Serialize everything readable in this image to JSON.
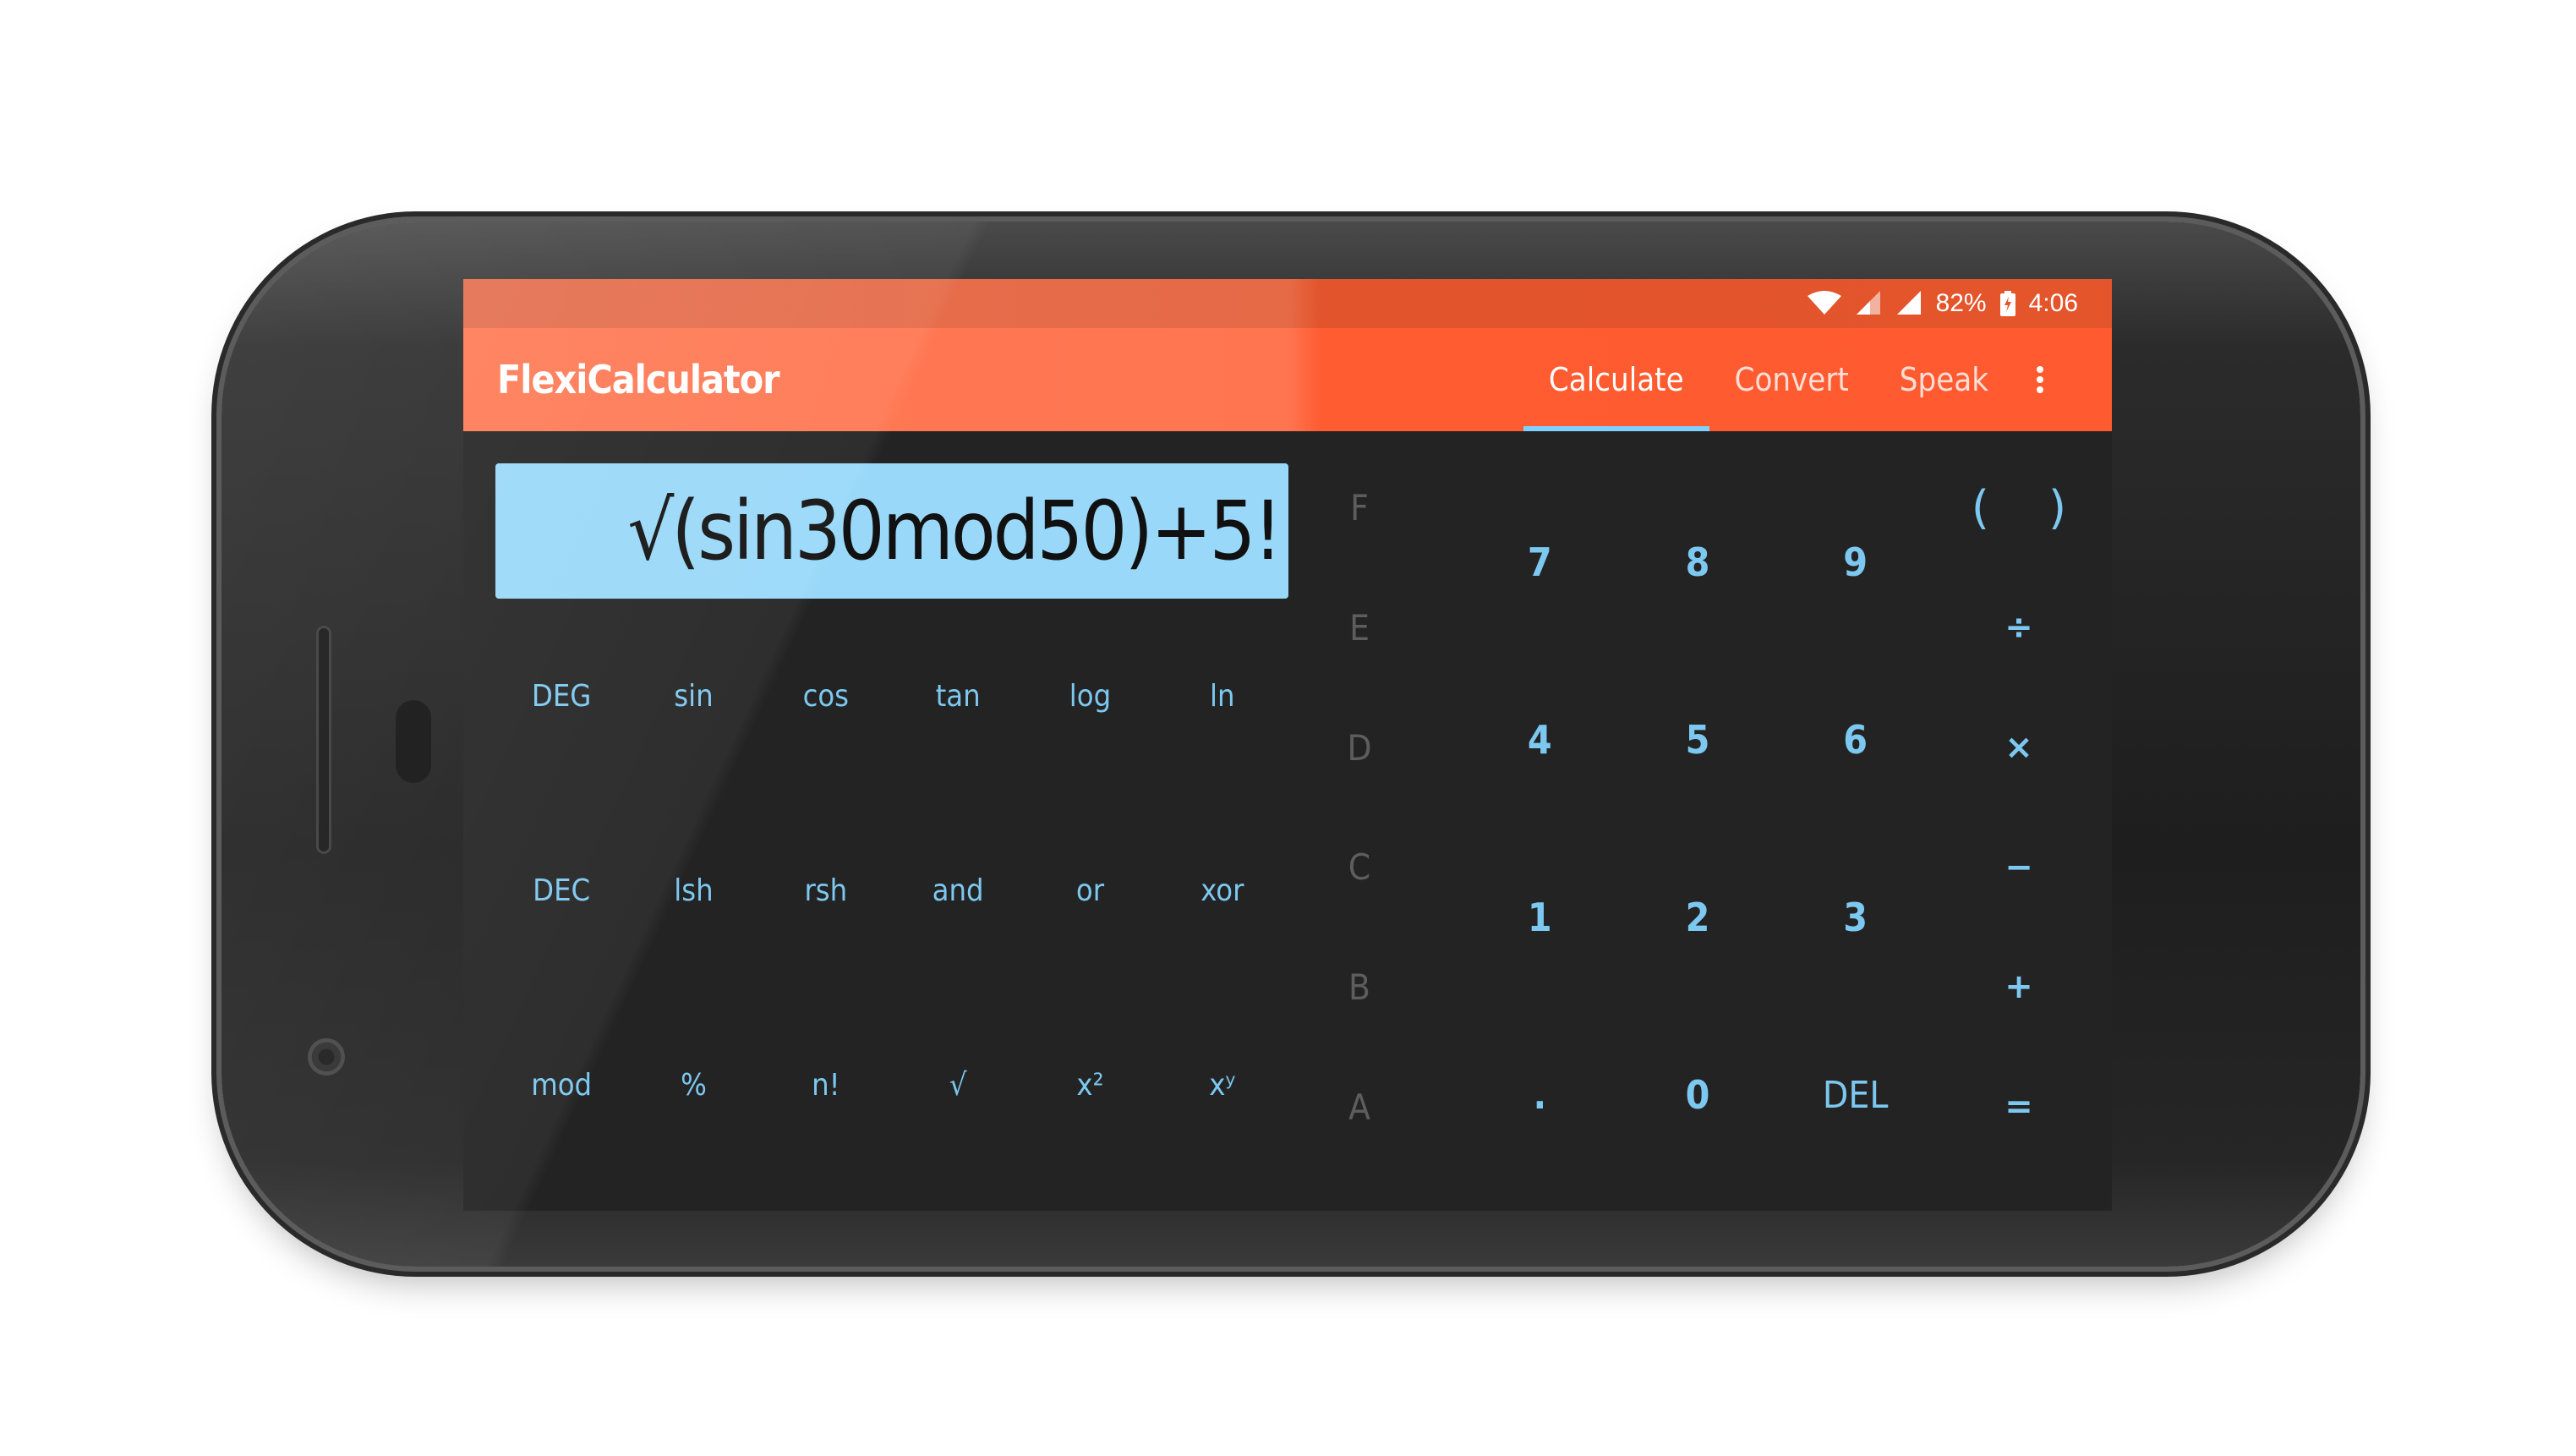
{
  "status_bar": {
    "battery": "82%",
    "time": "4:06"
  },
  "app_bar": {
    "title": "FlexiCalculator",
    "tabs": [
      {
        "label": "Calculate",
        "active": true
      },
      {
        "label": "Convert",
        "active": false
      },
      {
        "label": "Speak",
        "active": false
      }
    ]
  },
  "display": {
    "expression": "√(sin30mod50)+5!"
  },
  "scientific_keys": [
    [
      "DEG",
      "sin",
      "cos",
      "tan",
      "log",
      "ln"
    ],
    [
      "DEC",
      "lsh",
      "rsh",
      "and",
      "or",
      "xor"
    ],
    [
      "mod",
      "%",
      "n!",
      "√",
      "x²",
      "xʸ"
    ]
  ],
  "hex_keys": [
    "F",
    "E",
    "D",
    "C",
    "B",
    "A"
  ],
  "number_keys": [
    [
      "7",
      "8",
      "9"
    ],
    [
      "4",
      "5",
      "6"
    ],
    [
      "1",
      "2",
      "3"
    ],
    [
      ".",
      "0",
      "DEL"
    ]
  ],
  "operator_keys": {
    "open_paren": "(",
    "close_paren": ")",
    "divide": "÷",
    "multiply": "×",
    "subtract": "−",
    "add": "+",
    "equals": "="
  },
  "colors": {
    "accent": "#7cc8f0",
    "app_bar": "#ff6a40",
    "display_bg": "#99d8f9",
    "screen_bg": "#232323",
    "hex_text": "#5d5d5d"
  }
}
